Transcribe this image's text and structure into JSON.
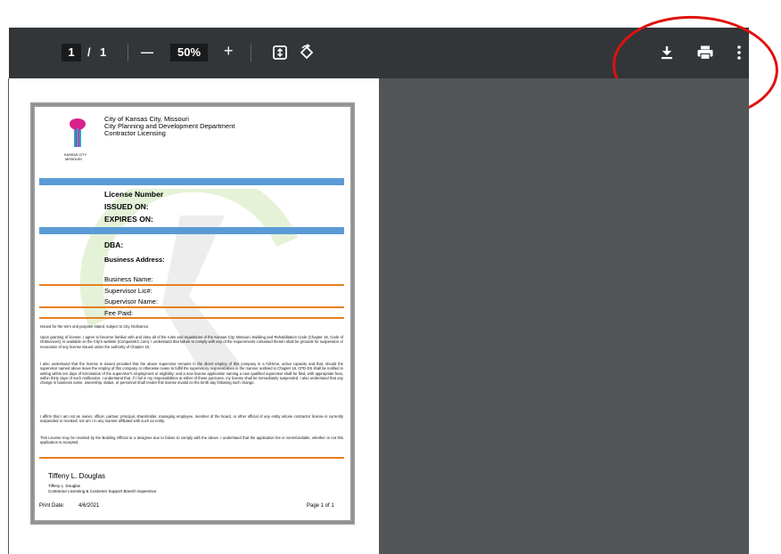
{
  "toolbar": {
    "page_current": "1",
    "page_sep": "/",
    "page_total": "1",
    "zoom_out_label": "—",
    "zoom_value": "50%",
    "zoom_in_label": "+",
    "icons": [
      "fit-page-icon",
      "rotate-icon",
      "download-icon",
      "print-icon",
      "more-vertical-icon"
    ],
    "colors": {
      "bar": "#323639",
      "viewer": "#525659"
    }
  },
  "document": {
    "org_line1": "City of Kansas City, Missouri",
    "org_line2": "City Planning and Development Department",
    "org_line3": "Contractor Licensing",
    "logo_text1": "KANSAS CITY",
    "logo_text2": "MISSOURI",
    "license_number": "License Number",
    "issued_on": "ISSUED ON:",
    "expires_on": "EXPIRES ON:",
    "dba": "DBA:",
    "business_address": "Business Address:",
    "business_name": "Business Name:",
    "supervisor_lic": "Supervisor Lic#:",
    "supervisor_name": "Supervisor Name:",
    "fee_paid": "Fee Paid:",
    "para1": "Issued for the term and purpose stated, subject to City Ordinance.",
    "para2": "Upon granting of license, I agree to become familiar with and obey all of the rules and regulations of the Kansas City, Missouri, Building and Rehabilitation Code (Chapter 18, Code of Ordinances), is available on the City's website (CompassKC.com). I understand that failure to comply with any of the requirements contained therein shall be grounds for suspension or revocation of any license issued under the authority of Chapter 18.",
    "para3": "I also understand that the license is issued provided that the above supervisor remains in the direct employ of this company in a full-time, active capacity and that, should the supervisor named above leave the employ of this company or otherwise cease to fulfill the supervisory responsibilities in the manner outlined in Chapter 18, CPD-DS shall be notified in writing within ten days of termination of the supervisor's employment or eligibility; and a new license application naming a new qualified supervisor shall be filed, with appropriate fees, within thirty days of such notification. I understand that, if I fail in my responsibilities at either of these junctures, my license shall be immediately suspended. I also understand that any change in business name, ownership, status, or personnel shall render this license invalid on the tenth day following such change.",
    "para4": "I affirm that I am not an owner, officer, partner, principal, shareholder, managing employee, member of the board, or other official of any entity whose contractor license is currently suspended or revoked; nor am I in any manner affiliated with such an entity.",
    "para5": "This License may be revoked by the Building Official or a designee due to failure to comply with the above. I understand that the application fee is nonrefundable, whether or not this application is accepted.",
    "signature": "Tiffeny L. Douglas",
    "signer_name": "Tiffeny L. Douglas",
    "signer_title": "Contractor Licensing & Customer Support Branch Supervisor",
    "print_date_label": "Print Date:",
    "print_date": "4/6/2021",
    "page_label": "Page 1 of 1"
  }
}
